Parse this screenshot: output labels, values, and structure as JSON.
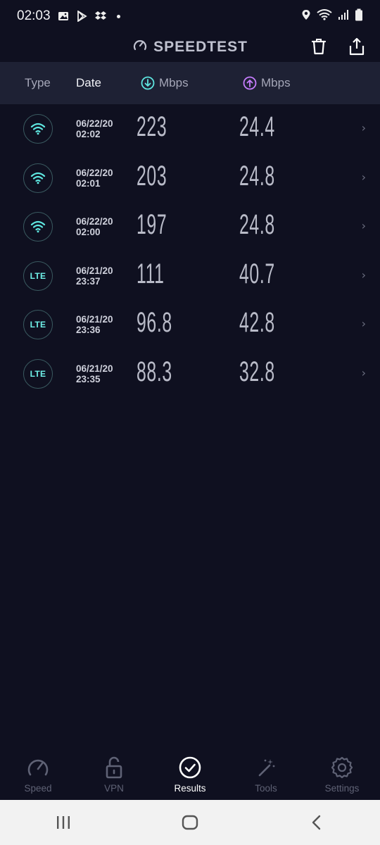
{
  "statusbar": {
    "time": "02:03"
  },
  "appbar": {
    "title": "SPEEDTEST"
  },
  "table_header": {
    "type": "Type",
    "date": "Date",
    "download_unit": "Mbps",
    "upload_unit": "Mbps"
  },
  "results": [
    {
      "type": "wifi",
      "date": "06/22/20",
      "time": "02:02",
      "download": "223",
      "upload": "24.4"
    },
    {
      "type": "wifi",
      "date": "06/22/20",
      "time": "02:01",
      "download": "203",
      "upload": "24.8"
    },
    {
      "type": "wifi",
      "date": "06/22/20",
      "time": "02:00",
      "download": "197",
      "upload": "24.8"
    },
    {
      "type": "LTE",
      "date": "06/21/20",
      "time": "23:37",
      "download": "111",
      "upload": "40.7"
    },
    {
      "type": "LTE",
      "date": "06/21/20",
      "time": "23:36",
      "download": "96.8",
      "upload": "42.8"
    },
    {
      "type": "LTE",
      "date": "06/21/20",
      "time": "23:35",
      "download": "88.3",
      "upload": "32.8"
    }
  ],
  "bottom_nav": {
    "speed": "Speed",
    "vpn": "VPN",
    "results": "Results",
    "tools": "Tools",
    "settings": "Settings"
  },
  "colors": {
    "background": "#0f1020",
    "header_bg": "#1e2134",
    "download_accent": "#5ee6e0",
    "upload_accent": "#c77dff"
  }
}
